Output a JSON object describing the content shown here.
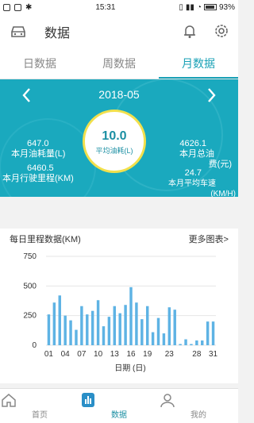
{
  "status_bar": {
    "time": "15:31",
    "battery": "93%"
  },
  "header": {
    "title": "数据",
    "icons": [
      "car-icon",
      "bell-icon",
      "gear-icon"
    ]
  },
  "tabs": [
    {
      "label": "日数据",
      "active": false
    },
    {
      "label": "周数据",
      "active": false
    },
    {
      "label": "月数据",
      "active": true
    }
  ],
  "summary": {
    "month": "2018-05",
    "fuel_used": {
      "value": "647.0",
      "label": "本月油耗量(L)"
    },
    "mileage": {
      "value": "6460.5",
      "label": "本月行驶里程(KM)"
    },
    "avg_fuel": {
      "value": "10.0",
      "label": "平均油耗(L)"
    },
    "fuel_cost": {
      "value": "4626.1",
      "label": "本月总油费(元)"
    },
    "avg_speed": {
      "value": "24.7",
      "label": "本月平均车速(KM/H)"
    },
    "accent": "#1aa9be",
    "ring_color": "#f2e04c"
  },
  "chart_title": "每日里程数据(KM)",
  "chart_more": "更多图表>",
  "chart_data": {
    "type": "bar",
    "title": "每日里程数据(KM)",
    "xlabel": "日期 (日)",
    "ylabel": "",
    "ylim": [
      0,
      750
    ],
    "yticks": [
      "750",
      "500",
      "250",
      "0"
    ],
    "xticks": [
      "01",
      "04",
      "07",
      "10",
      "13",
      "16",
      "19",
      "23",
      "28",
      "31"
    ],
    "categories": [
      "01",
      "02",
      "03",
      "04",
      "05",
      "06",
      "07",
      "08",
      "09",
      "10",
      "11",
      "12",
      "13",
      "14",
      "15",
      "16",
      "17",
      "18",
      "19",
      "20",
      "21",
      "22",
      "23",
      "24",
      "25",
      "26",
      "27",
      "28",
      "29",
      "30",
      "31"
    ],
    "values": [
      260,
      360,
      420,
      250,
      210,
      130,
      330,
      260,
      290,
      380,
      160,
      240,
      330,
      270,
      340,
      490,
      360,
      220,
      330,
      110,
      230,
      100,
      320,
      300,
      10,
      50,
      10,
      40,
      40,
      200,
      200
    ],
    "bar_color": "#5eb3e4",
    "grid": true
  },
  "bottom_nav": [
    {
      "label": "首页",
      "active": false
    },
    {
      "label": "数据",
      "active": true
    },
    {
      "label": "我的",
      "active": false
    }
  ]
}
